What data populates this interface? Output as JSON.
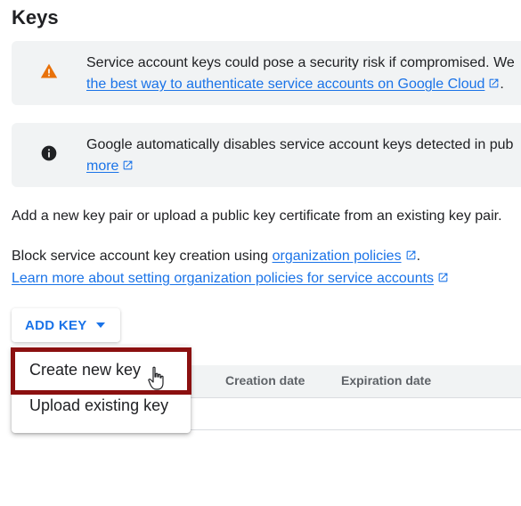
{
  "section_title": "Keys",
  "warning_banner": {
    "icon": "warning-icon",
    "line1": "Service account keys could pose a security risk if compromised. We",
    "link_text": "the best way to authenticate service accounts on Google Cloud",
    "after_link": "."
  },
  "info_banner": {
    "icon": "info-icon",
    "line1": "Google automatically disables service account keys detected in pub",
    "link_text": "more"
  },
  "add_key_text": "Add a new key pair or upload a public key certificate from an existing key pair.",
  "block_text": {
    "prefix": "Block service account key creation using ",
    "link_text": "organization policies",
    "suffix": "."
  },
  "learn_more_link": "Learn more about setting organization policies for service accounts",
  "add_key_button": "ADD KEY",
  "table": {
    "columns": [
      "Creation date",
      "Expiration date"
    ]
  },
  "menu": {
    "items": [
      "Create new key",
      "Upload existing key"
    ]
  },
  "colors": {
    "link": "#1a73e8",
    "warning": "#e8710a",
    "highlight": "#8b1010"
  }
}
